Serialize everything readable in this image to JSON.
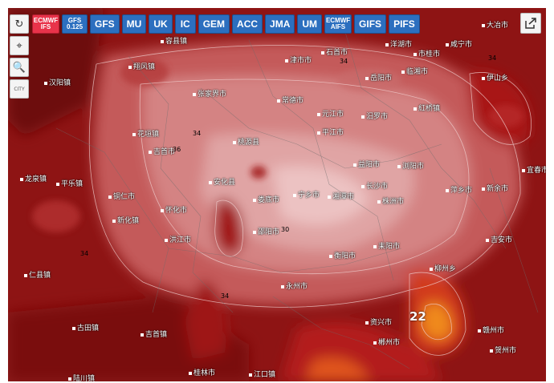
{
  "models": [
    {
      "label": "ECMWF IFS",
      "active": true
    },
    {
      "label": "GFS 0.125",
      "active": false
    },
    {
      "label": "GFS",
      "active": false
    },
    {
      "label": "MU",
      "active": false
    },
    {
      "label": "UK",
      "active": false
    },
    {
      "label": "IC",
      "active": false
    },
    {
      "label": "GEM",
      "active": false
    },
    {
      "label": "ACC",
      "active": false
    },
    {
      "label": "JMA",
      "active": false
    },
    {
      "label": "UM",
      "active": false
    },
    {
      "label": "ECMWF AIFS",
      "active": false
    },
    {
      "label": "GIFS",
      "active": false
    },
    {
      "label": "PIFS",
      "active": false
    }
  ],
  "tools": {
    "refresh": "↻",
    "locate": "⌖",
    "zoom": "🔍",
    "city": "CITY"
  },
  "labels": {
    "t1": "容县镇",
    "t2": "洋湖市",
    "t3": "咸宁市",
    "t4": "大冶市",
    "t5": "石首市",
    "t6": "市桂市",
    "t7": "汉阳镇",
    "t8": "翔风镇",
    "t9": "津市市",
    "t10": "岳阳市",
    "t11": "临湘市",
    "t12": "伊山乡",
    "t13": "张家界市",
    "t14": "常德市",
    "t15": "紅桥镇",
    "t16": "元江市",
    "t17": "汨罗市",
    "t18": "平江市",
    "t19": "桃源县",
    "t20": "花垣镇",
    "t21": "吉首市",
    "t22": "益阳市",
    "t23": "安化县",
    "t24": "长沙市",
    "t25": "浏阳市",
    "t26": "铜仁市",
    "t27": "娄底市",
    "t28": "湘潭市",
    "t29": "宁乡市",
    "t30": "株洲市",
    "t31": "邵阳市",
    "t32": "衡阳市",
    "t33": "耒阳市",
    "t34": "永州市",
    "t35": "郴州市",
    "t36": "资兴市",
    "t37": "新化镇",
    "t38": "怀化市",
    "t39": "洪江市",
    "t40": "柳州乡",
    "t41": "赣州市",
    "t42": "吉安市",
    "t43": "新余市",
    "t44": "萍乡市",
    "t45": "宜春市",
    "t46": "古田镇",
    "t47": "吉首镇",
    "t48": "江口镇",
    "t49": "桂林市",
    "t50": "龙泉镇",
    "t51": "平乐镇",
    "t52": "仁县镇",
    "t53": "贺州市",
    "t54": "陆川镇"
  },
  "contours": {
    "c1": "34",
    "c2": "34",
    "c3": "34",
    "c4": "34",
    "c5": "34",
    "c6": "36",
    "c7": "30"
  },
  "min_value": "22"
}
